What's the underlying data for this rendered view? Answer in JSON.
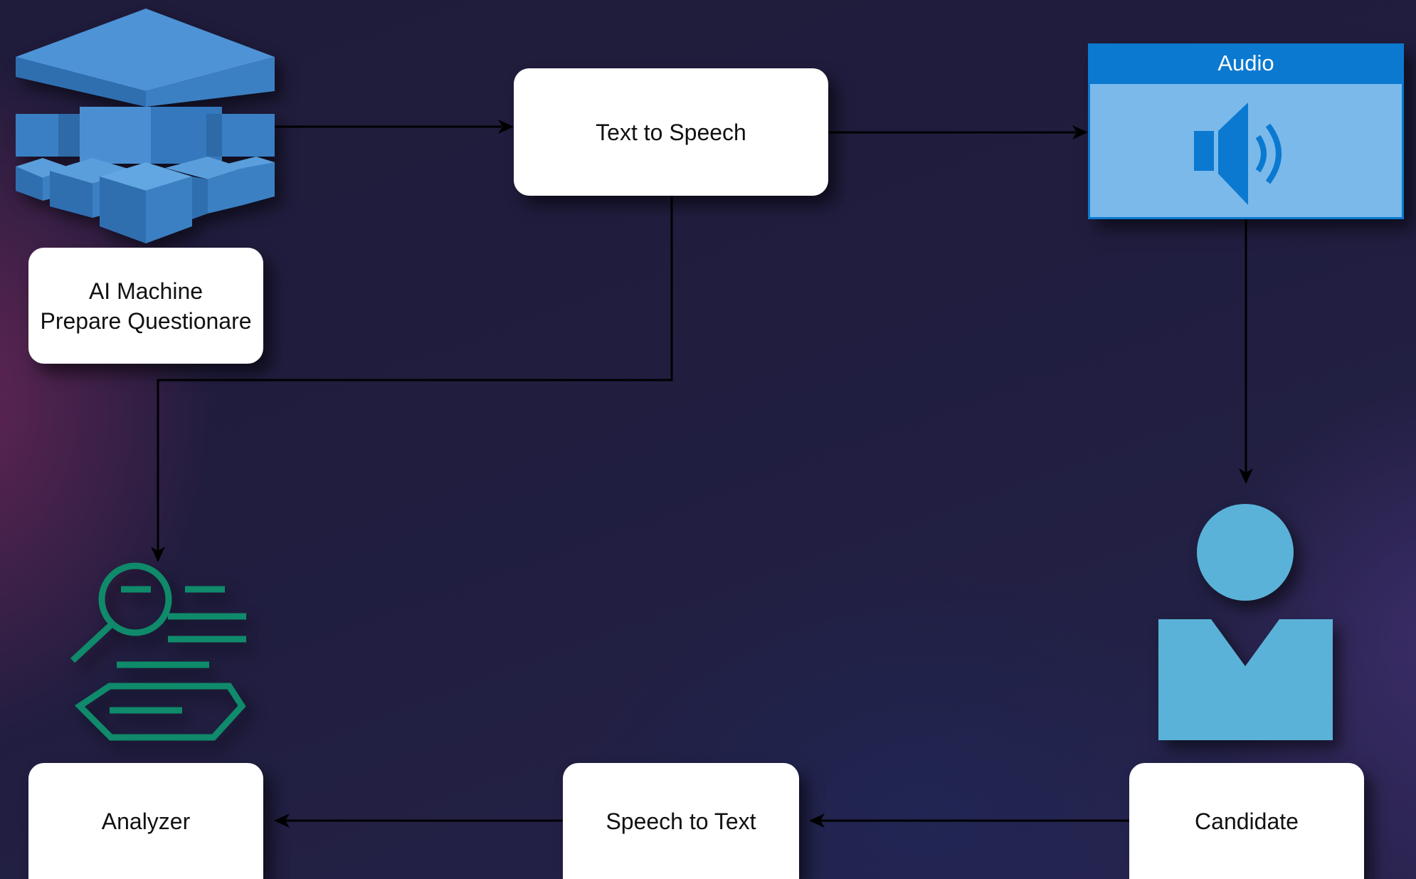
{
  "nodes": {
    "ai_machine": "AI Machine\nPrepare Questionare",
    "text_to_speech": "Text to Speech",
    "audio": "Audio",
    "analyzer": "Analyzer",
    "speech_to_text": "Speech to Text",
    "candidate": "Candidate"
  },
  "edges": [
    {
      "from": "ai_machine",
      "to": "text_to_speech"
    },
    {
      "from": "text_to_speech",
      "to": "audio"
    },
    {
      "from": "text_to_speech",
      "to": "analyzer"
    },
    {
      "from": "audio",
      "to": "candidate"
    },
    {
      "from": "candidate",
      "to": "speech_to_text"
    },
    {
      "from": "speech_to_text",
      "to": "analyzer"
    }
  ],
  "icons": {
    "ai": "machine-learning-cubes-icon",
    "audio": "speaker-icon",
    "analyzer": "search-analyzer-icon",
    "candidate": "person-icon"
  },
  "colors": {
    "cube_blue": "#3a7fc4",
    "audio_header": "#0b79d0",
    "audio_body": "#7ab9ea",
    "analyzer_green": "#0f8a6a",
    "person_blue": "#5ab2d8"
  }
}
